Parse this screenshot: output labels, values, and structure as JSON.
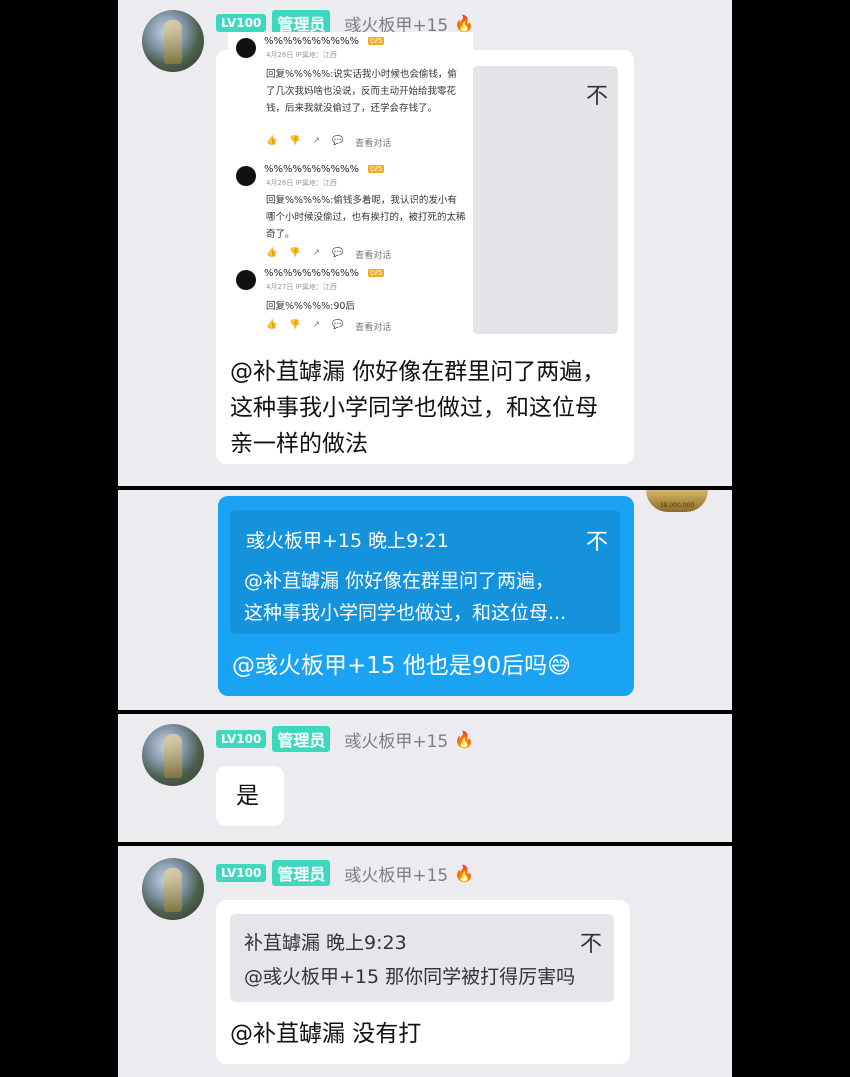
{
  "messages": {
    "m1": {
      "lv": "LV100",
      "role": "管理员",
      "username": "彧火板甲+15",
      "close_icon": "不",
      "screenshot": {
        "c1": {
          "name": "%%%%%%%%%%",
          "badge": "LV5",
          "meta": "4月26日 IP属地：江西",
          "body": "回复%%%%%:说实话我小时候也会偷钱，偷了几次我妈啥也没说，反而主动开始给我零花钱，后来我就没偷过了，还学会存钱了。",
          "view": "查看对话"
        },
        "c2": {
          "name": "%%%%%%%%%%",
          "badge": "LV5",
          "meta": "4月26日 IP属地：江西",
          "body": "回复%%%%%:偷钱多着呢，我认识的发小有哪个小时候没偷过，也有挨打的，被打死的太稀奇了。",
          "view": "查看对话"
        },
        "c3": {
          "name": "%%%%%%%%%%",
          "badge": "LV5",
          "meta": "4月27日 IP属地：江西",
          "body": "回复%%%%%:90后",
          "view": "查看对话"
        }
      },
      "text": "@补苴罅漏 你好像在群里问了两遍，这种事我小学同学也做过，和这位母亲一样的做法"
    },
    "m2": {
      "avatar_caption": "38,000,000",
      "quote_head": "彧火板甲+15 晚上9:21",
      "quote_close": "不",
      "quote_line1": "@补苴罅漏 你好像在群里问了两遍，",
      "quote_line2": "这种事我小学同学也做过，和这位母...",
      "text": "@彧火板甲+15 他也是90后吗😅"
    },
    "m3": {
      "lv": "LV100",
      "role": "管理员",
      "username": "彧火板甲+15",
      "text": "是"
    },
    "m4": {
      "lv": "LV100",
      "role": "管理员",
      "username": "彧火板甲+15",
      "quote_head": "补苴罅漏 晚上9:23",
      "quote_close": "不",
      "quote_body": "@彧火板甲+15 那你同学被打得厉害吗",
      "text": "@补苴罅漏 没有打"
    }
  }
}
